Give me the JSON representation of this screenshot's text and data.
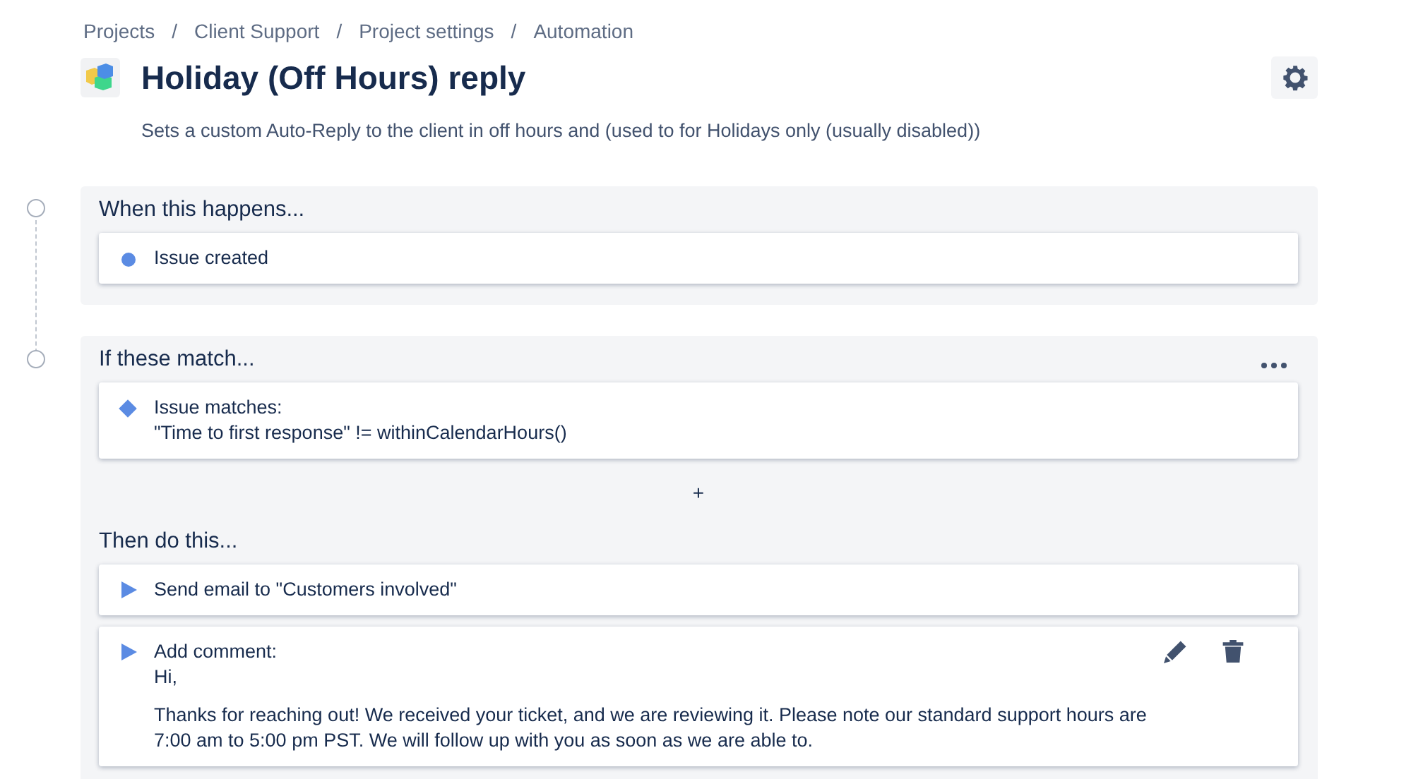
{
  "breadcrumbs": [
    "Projects",
    "Client Support",
    "Project settings",
    "Automation"
  ],
  "breadcrumb_separator": "/",
  "rule": {
    "title": "Holiday (Off Hours) reply",
    "description": "Sets a custom Auto-Reply to the client in off hours and (used to for Holidays only (usually disabled))"
  },
  "trigger": {
    "heading": "When this happens...",
    "items": [
      {
        "kind": "trigger",
        "lines": [
          "Issue created"
        ]
      }
    ]
  },
  "conditions": {
    "heading": "If these match...",
    "items": [
      {
        "kind": "condition",
        "lines": [
          "Issue matches:",
          "\"Time to first response\" != withinCalendarHours()"
        ]
      }
    ],
    "add": "+"
  },
  "actions": {
    "heading": "Then do this...",
    "items": [
      {
        "kind": "action",
        "lines": [
          "Send email to \"Customers involved\""
        ]
      },
      {
        "kind": "action",
        "lines": [
          "Add comment:",
          "Hi,",
          "Thanks for reaching out! We received your ticket, and we are reviewing it. Please note our standard support hours are 7:00 am to 5:00 pm PST. We will follow up with you as soon as we are able to."
        ],
        "editable": true
      }
    ]
  }
}
